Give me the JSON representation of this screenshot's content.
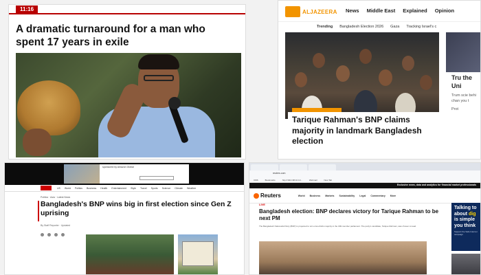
{
  "panel1": {
    "time": "11:16",
    "headline": "A dramatic turnaround for a man who spent 17 years in exile"
  },
  "panel2": {
    "logo": "ALJAZEERA",
    "nav": [
      "News",
      "Middle East",
      "Explained",
      "Opinion"
    ],
    "subnav": [
      "Trending",
      "Bangladesh Election 2026",
      "Gaza",
      "Tracking Israel's c"
    ],
    "headline": "Tarique Rahman's BNP claims majority in landmark Bangladesh election",
    "side_title": "Tru the Uni",
    "side_snippet": "Trum scie behi chan you t",
    "side_more": "Prot"
  },
  "panel3": {
    "ad_label": "sponsored by Amazon Global",
    "nav": [
      "US",
      "World",
      "Politics",
      "Business",
      "Health",
      "Entertainment",
      "Style",
      "Travel",
      "Sports",
      "Science",
      "Climate",
      "Weather"
    ],
    "crumbs": "Politics · Asia · Latest News",
    "headline": "Bangladesh's BNP wins big in first election since Gen Z uprising",
    "byline": "By Staff Reporter · Updated"
  },
  "panel4": {
    "url": "reuters.com",
    "bookmarks": [
      "CMS",
      "Bookmarks",
      "http://192.168.10.10...",
      "Webmail",
      "New Tab"
    ],
    "promo": "Exclusive news, data and analytics for financial market professionals",
    "logo": "Reuters",
    "nav": [
      "World",
      "Business",
      "Markets",
      "Sustainability",
      "Legal",
      "Commentary",
      "More"
    ],
    "live": "LIVE",
    "headline": "Bangladesh election: BNP declares victory for Tarique Rahman to be next PM",
    "summary": "The Bangladesh Nationalist Party (BNP) is projected to win a two-thirds majority in the 300-member parliament. The party's candidate, Tarique Rahman, was chosen to lead.",
    "ad_title_1": "Talking to",
    "ad_title_2": "about",
    "ad_title_hl": "dig",
    "ad_title_3": "is simple",
    "ad_title_4": "you think",
    "ad_sub": "Support the Safe Internet campaign"
  },
  "colors": {
    "bbc_red": "#b80000",
    "aljazeera_orange": "#f29400",
    "cnn_red": "#cc0000",
    "reuters_orange": "#fa6400"
  }
}
